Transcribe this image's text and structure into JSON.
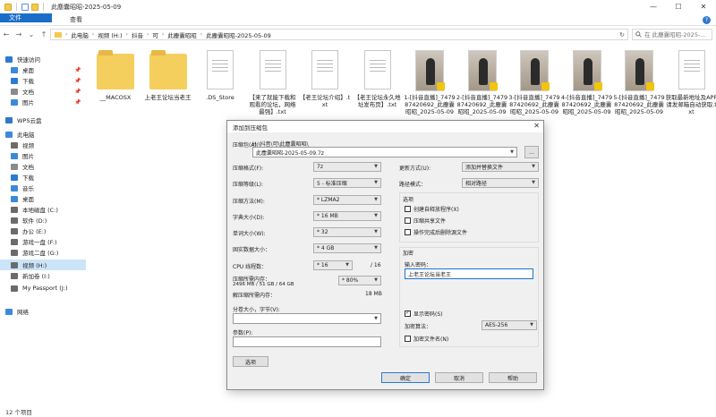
{
  "window": {
    "title": "此塵囊昭昭-2025-05-09",
    "minimize": "—",
    "maximize": "☐",
    "close": "✕"
  },
  "ribbon": {
    "tabs": [
      "文件",
      "主页",
      "共享",
      "查看"
    ],
    "help": "?"
  },
  "address": {
    "back": "←",
    "forward": "→",
    "recent": "⌄",
    "up": "↑",
    "crumbs": [
      "此电脑",
      "视频 (H:)",
      "抖音",
      "可",
      "此塵囊昭昭",
      "此塵囊昭昭-2025-05-09"
    ],
    "refresh": "↻",
    "search_placeholder": "在 此塵囊昭昭-2025-..."
  },
  "sidebar": {
    "items": [
      {
        "label": "快速访问",
        "icon": "star-icon",
        "color": "#2f78d0"
      },
      {
        "label": "桌面",
        "icon": "desktop-icon",
        "color": "#3b8ad9",
        "pin": "📌"
      },
      {
        "label": "下载",
        "icon": "download-icon",
        "color": "#2a7bd4",
        "pin": "📌"
      },
      {
        "label": "文档",
        "icon": "document-icon",
        "color": "#8a8a8a",
        "pin": "📌"
      },
      {
        "label": "图片",
        "icon": "picture-icon",
        "color": "#3b8ad9",
        "pin": "📌"
      },
      {
        "label": "WPS云盘",
        "icon": "cloud-icon",
        "color": "#3178c6"
      },
      {
        "label": "此电脑",
        "icon": "computer-icon",
        "color": "#3b8ad9"
      },
      {
        "label": "视频",
        "icon": "video-icon",
        "color": "#6b6b6b"
      },
      {
        "label": "图片",
        "icon": "picture-icon",
        "color": "#3b8ad9"
      },
      {
        "label": "文档",
        "icon": "document-icon",
        "color": "#8a8a8a"
      },
      {
        "label": "下载",
        "icon": "download-icon",
        "color": "#2a7bd4"
      },
      {
        "label": "音乐",
        "icon": "music-icon",
        "color": "#3b8ad9"
      },
      {
        "label": "桌面",
        "icon": "desktop-icon",
        "color": "#3b8ad9"
      },
      {
        "label": "本地磁盘 (C:)",
        "icon": "drive-icon",
        "color": "#6b6b6b"
      },
      {
        "label": "软件 (D:)",
        "icon": "drive-icon",
        "color": "#6b6b6b"
      },
      {
        "label": "办公 (E:)",
        "icon": "drive-icon",
        "color": "#6b6b6b"
      },
      {
        "label": "游戏一盘 (F:)",
        "icon": "drive-icon",
        "color": "#6b6b6b"
      },
      {
        "label": "游戏二盘 (G:)",
        "icon": "drive-icon",
        "color": "#6b6b6b"
      },
      {
        "label": "视频 (H:)",
        "icon": "drive-icon",
        "color": "#6b6b6b",
        "selected": true
      },
      {
        "label": "新加卷 (I:)",
        "icon": "drive-icon",
        "color": "#6b6b6b"
      },
      {
        "label": "My Passport (J:)",
        "icon": "drive-icon",
        "color": "#6b6b6b"
      },
      {
        "label": "网络",
        "icon": "network-icon",
        "color": "#3b8ad9"
      }
    ]
  },
  "files": [
    {
      "kind": "folder",
      "label": "__MACOSX"
    },
    {
      "kind": "folder",
      "label": "上老王论坛当老王"
    },
    {
      "kind": "doc",
      "label": ".DS_Store"
    },
    {
      "kind": "doc",
      "label": "【来了就能下载和观看的论坛，网络最强】.txt"
    },
    {
      "kind": "doc",
      "label": "【老王论坛介绍】.txt"
    },
    {
      "kind": "doc",
      "label": "【老王论坛永久地址发布页】.txt"
    },
    {
      "kind": "photo",
      "label": "1-[抖音直播]_747987420692_此塵囊昭昭_2025-05-09"
    },
    {
      "kind": "photo",
      "label": "2-[抖音直播]_747987420692_此塵囊昭昭_2025-05-09"
    },
    {
      "kind": "photo",
      "label": "3-[抖音直播]_747987420692_此塵囊昭昭_2025-05-09"
    },
    {
      "kind": "photo",
      "label": "4-[抖音直播]_747987420692_此塵囊昭昭_2025-05-09"
    },
    {
      "kind": "photo",
      "label": "5-[抖音直播]_747987420692_此塵囊昭昭_2025-05-09"
    },
    {
      "kind": "doc",
      "label": "获取最新地址及APP请发邮箱自动获取.txt"
    }
  ],
  "status": {
    "count": "12 个项目"
  },
  "dialog": {
    "title": "添加到压缩包",
    "close": "✕",
    "archive_label": "压缩包(A):",
    "archive_dir": "H:\\抖音\\可\\此塵囊昭昭\\",
    "archive_name": "此塵囊昭昭-2025-05-09.7z",
    "browse": "...",
    "format_label": "压缩格式(F):",
    "format_value": "7z",
    "level_label": "压缩等级(L):",
    "level_value": "5 - 标准压缩",
    "method_label": "压缩方法(M):",
    "method_value": "* LZMA2",
    "dict_label": "字典大小(D):",
    "dict_value": "* 16 MB",
    "word_label": "单词大小(W):",
    "word_value": "* 32",
    "solid_label": "固实数据大小：",
    "solid_value": "* 4 GB",
    "threads_label": "CPU 线程数：",
    "threads_value": "* 16",
    "threads_max": "/ 16",
    "mem_label": "压缩所需内存：",
    "mem_detail": "2496 MB / 51 GB / 64 GB",
    "mem_value": "* 80%",
    "decomp_label": "解压缩所需内存：",
    "decomp_value": "18 MB",
    "split_label": "分卷大小，字节(V):",
    "params_label": "参数(P):",
    "options_button": "选项",
    "update_label": "更新方式(U):",
    "update_value": "添加并替换文件",
    "path_label": "路径模式：",
    "path_value": "相对路径",
    "options_group": "选项",
    "opt_sfx": "创建自释放程序(X)",
    "opt_shared": "压缩共享文件",
    "opt_delete": "操作完成后删除源文件",
    "encrypt_group": "加密",
    "pw_label": "输入密码：",
    "pw_value": "上老王论坛当老王",
    "show_pw": "显示密码(S)",
    "enc_method_label": "加密算法：",
    "enc_method_value": "AES-256",
    "enc_names": "加密文件名(N)",
    "ok": "确定",
    "cancel": "取消",
    "help": "帮助"
  }
}
